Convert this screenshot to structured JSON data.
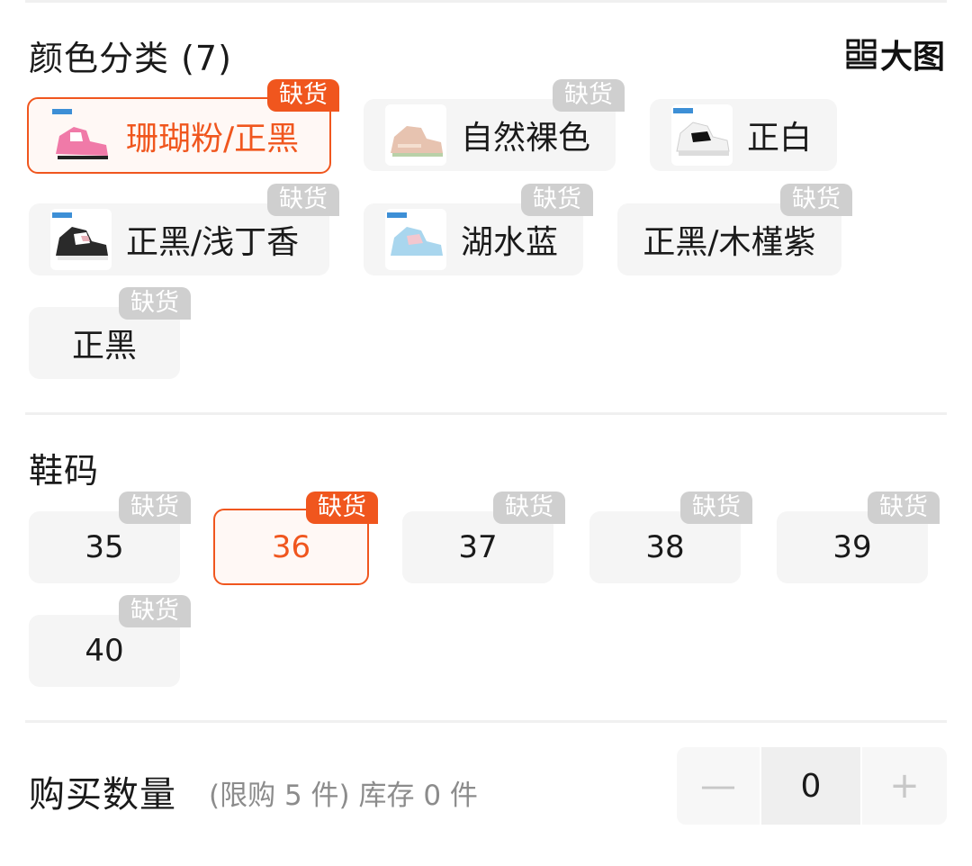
{
  "color_section": {
    "title": "颜色分类 (7)",
    "big_image_label": "大图",
    "options": [
      {
        "label": "珊瑚粉/正黑",
        "badge": "缺货",
        "selected": true,
        "thumb": "pink"
      },
      {
        "label": "自然裸色",
        "badge": "缺货",
        "selected": false,
        "thumb": "nude"
      },
      {
        "label": "正白",
        "badge": "",
        "selected": false,
        "thumb": "white"
      },
      {
        "label": "正黑/浅丁香",
        "badge": "缺货",
        "selected": false,
        "thumb": "black-lilac"
      },
      {
        "label": "湖水蓝",
        "badge": "缺货",
        "selected": false,
        "thumb": "blue"
      },
      {
        "label": "正黑/木槿紫",
        "badge": "缺货",
        "selected": false,
        "thumb": ""
      },
      {
        "label": "正黑",
        "badge": "缺货",
        "selected": false,
        "thumb": ""
      }
    ]
  },
  "size_section": {
    "title": "鞋码",
    "options": [
      {
        "label": "35",
        "badge": "缺货",
        "selected": false
      },
      {
        "label": "36",
        "badge": "缺货",
        "selected": true
      },
      {
        "label": "37",
        "badge": "缺货",
        "selected": false
      },
      {
        "label": "38",
        "badge": "缺货",
        "selected": false
      },
      {
        "label": "39",
        "badge": "缺货",
        "selected": false
      },
      {
        "label": "40",
        "badge": "缺货",
        "selected": false
      }
    ]
  },
  "quantity": {
    "title": "购买数量",
    "note": "(限购 5 件) 库存 0 件",
    "value": "0",
    "minus_symbol": "—",
    "plus_symbol": "+"
  },
  "colors": {
    "accent": "#f0561e",
    "badge_gray": "#cfcfcf",
    "option_bg": "#f5f5f5"
  }
}
